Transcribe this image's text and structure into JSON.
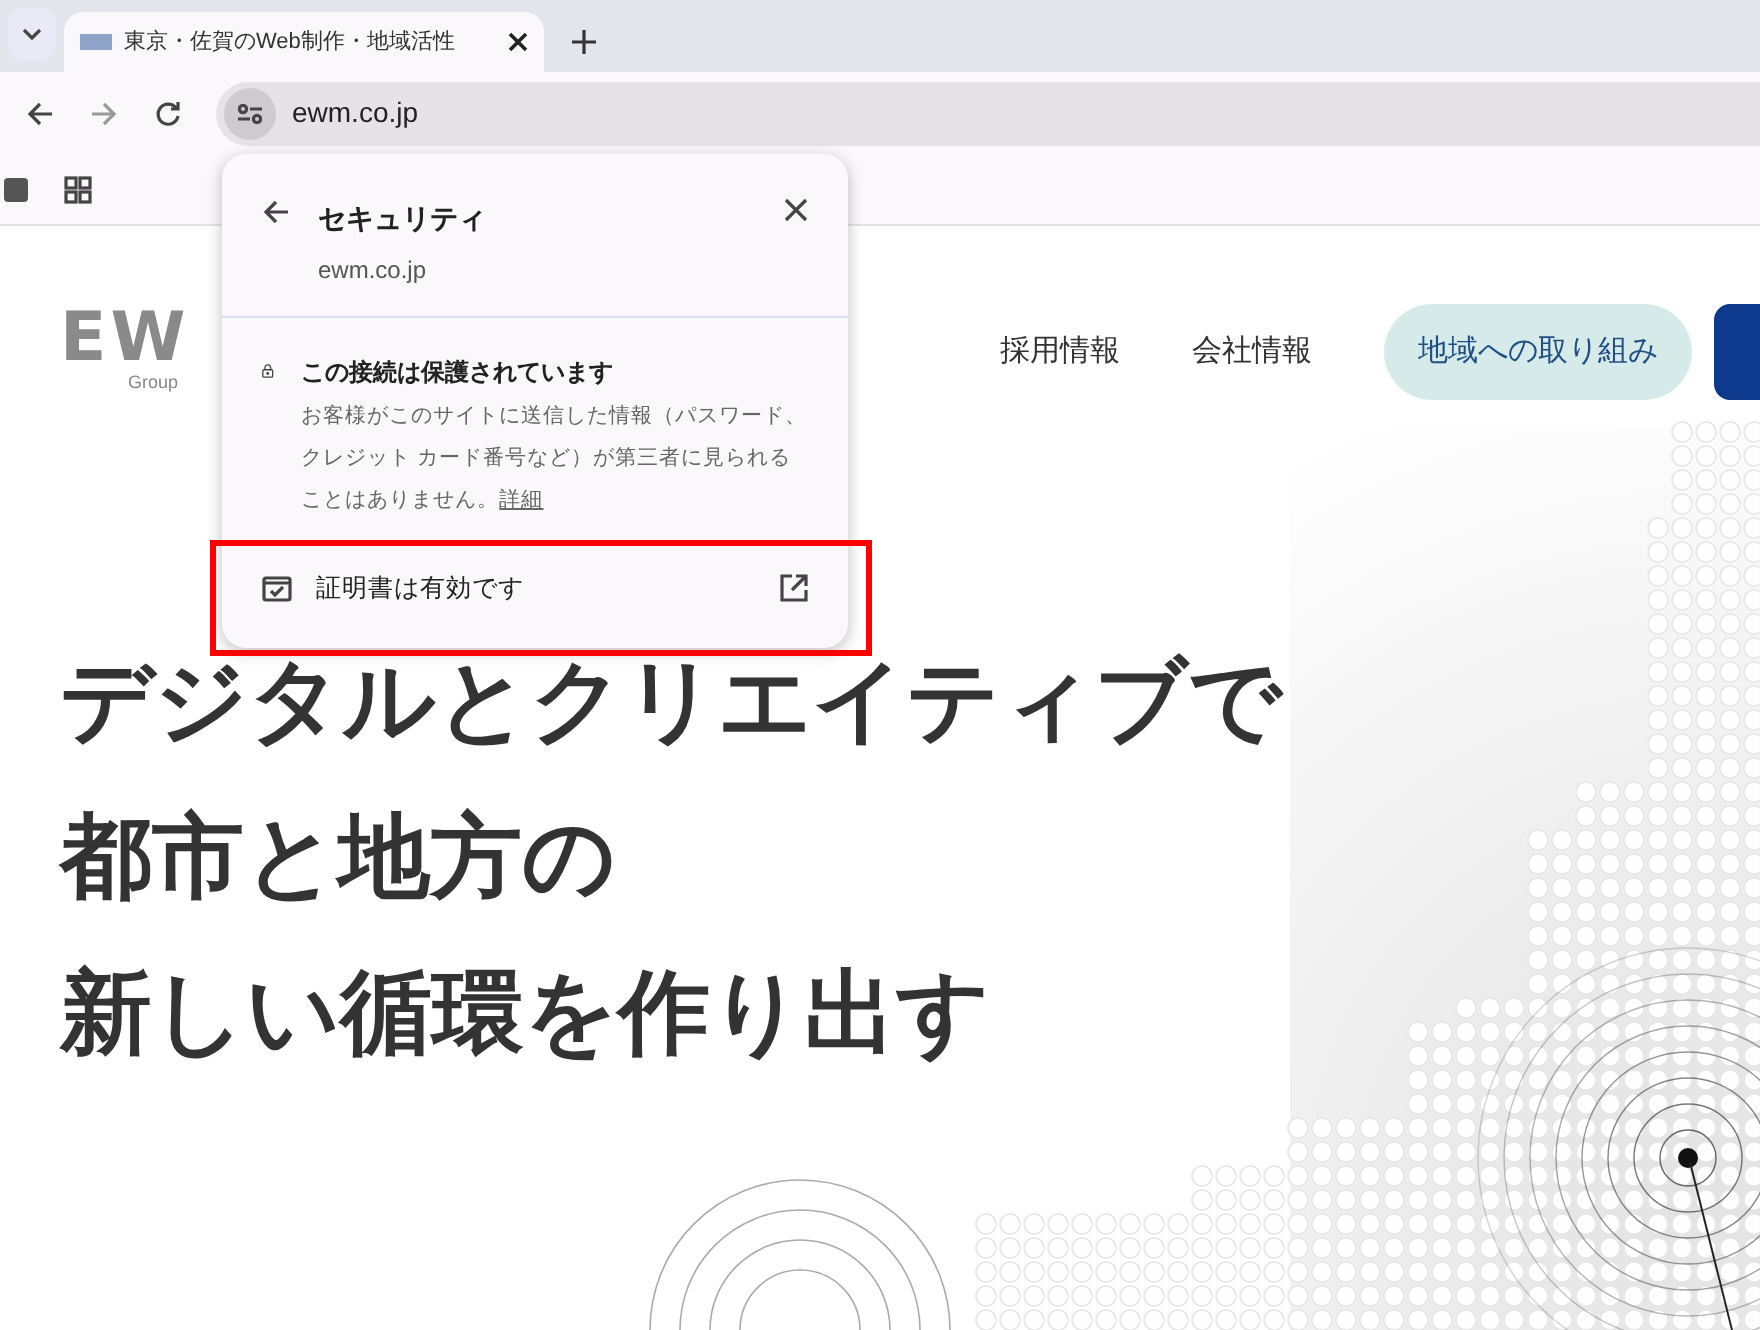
{
  "browser": {
    "tabs": [
      {
        "title": "東京・佐賀のWeb制作・地域活性",
        "selected": true
      }
    ],
    "address": "ewm.co.jp"
  },
  "security_popup": {
    "title": "セキュリティ",
    "domain": "ewm.co.jp",
    "connection": {
      "heading": "この接続は保護されています",
      "description": "お客様がこのサイトに送信した情報（パスワード、クレジット カード番号など）が第三者に見られることはありません。",
      "link": "詳細"
    },
    "certificate": {
      "label": "証明書は有効です",
      "highlighted": true
    }
  },
  "site": {
    "logo": {
      "letters": "EW",
      "sub": "Group"
    },
    "nav": [
      {
        "label": "採用情報",
        "kind": "link"
      },
      {
        "label": "会社情報",
        "kind": "link"
      },
      {
        "label": "地域への取り組み",
        "kind": "pill"
      },
      {
        "kind": "solid"
      }
    ],
    "headline": [
      "デジタルとクリエイティブで",
      "都市と地方の",
      "新しい循環を作り出す"
    ]
  }
}
